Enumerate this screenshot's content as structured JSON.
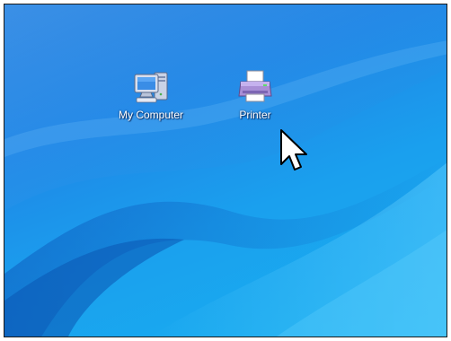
{
  "desktop": {
    "icons": [
      {
        "label": "My Computer",
        "icon": "my-computer-icon"
      },
      {
        "label": "Printer",
        "icon": "printer-icon"
      }
    ]
  },
  "colors": {
    "wallpaper": "#1f8fe8",
    "label_text": "#ffffff"
  }
}
